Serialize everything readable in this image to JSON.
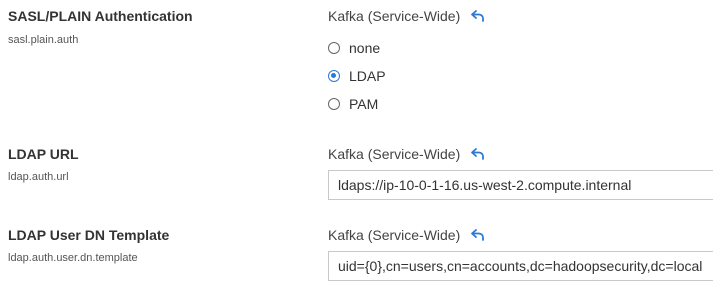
{
  "settings": [
    {
      "title": "SASL/PLAIN Authentication",
      "key": "sasl.plain.auth",
      "scope": "Kafka (Service-Wide)",
      "options": [
        "none",
        "LDAP",
        "PAM"
      ],
      "selected": "LDAP"
    },
    {
      "title": "LDAP URL",
      "key": "ldap.auth.url",
      "scope": "Kafka (Service-Wide)",
      "value": "ldaps://ip-10-0-1-16.us-west-2.compute.internal"
    },
    {
      "title": "LDAP User DN Template",
      "key": "ldap.auth.user.dn.template",
      "scope": "Kafka (Service-Wide)",
      "value": "uid={0},cn=users,cn=accounts,dc=hadoopsecurity,dc=local"
    }
  ],
  "icons": {
    "undo": "undo-icon"
  },
  "colors": {
    "accent": "#2a7ad5"
  }
}
